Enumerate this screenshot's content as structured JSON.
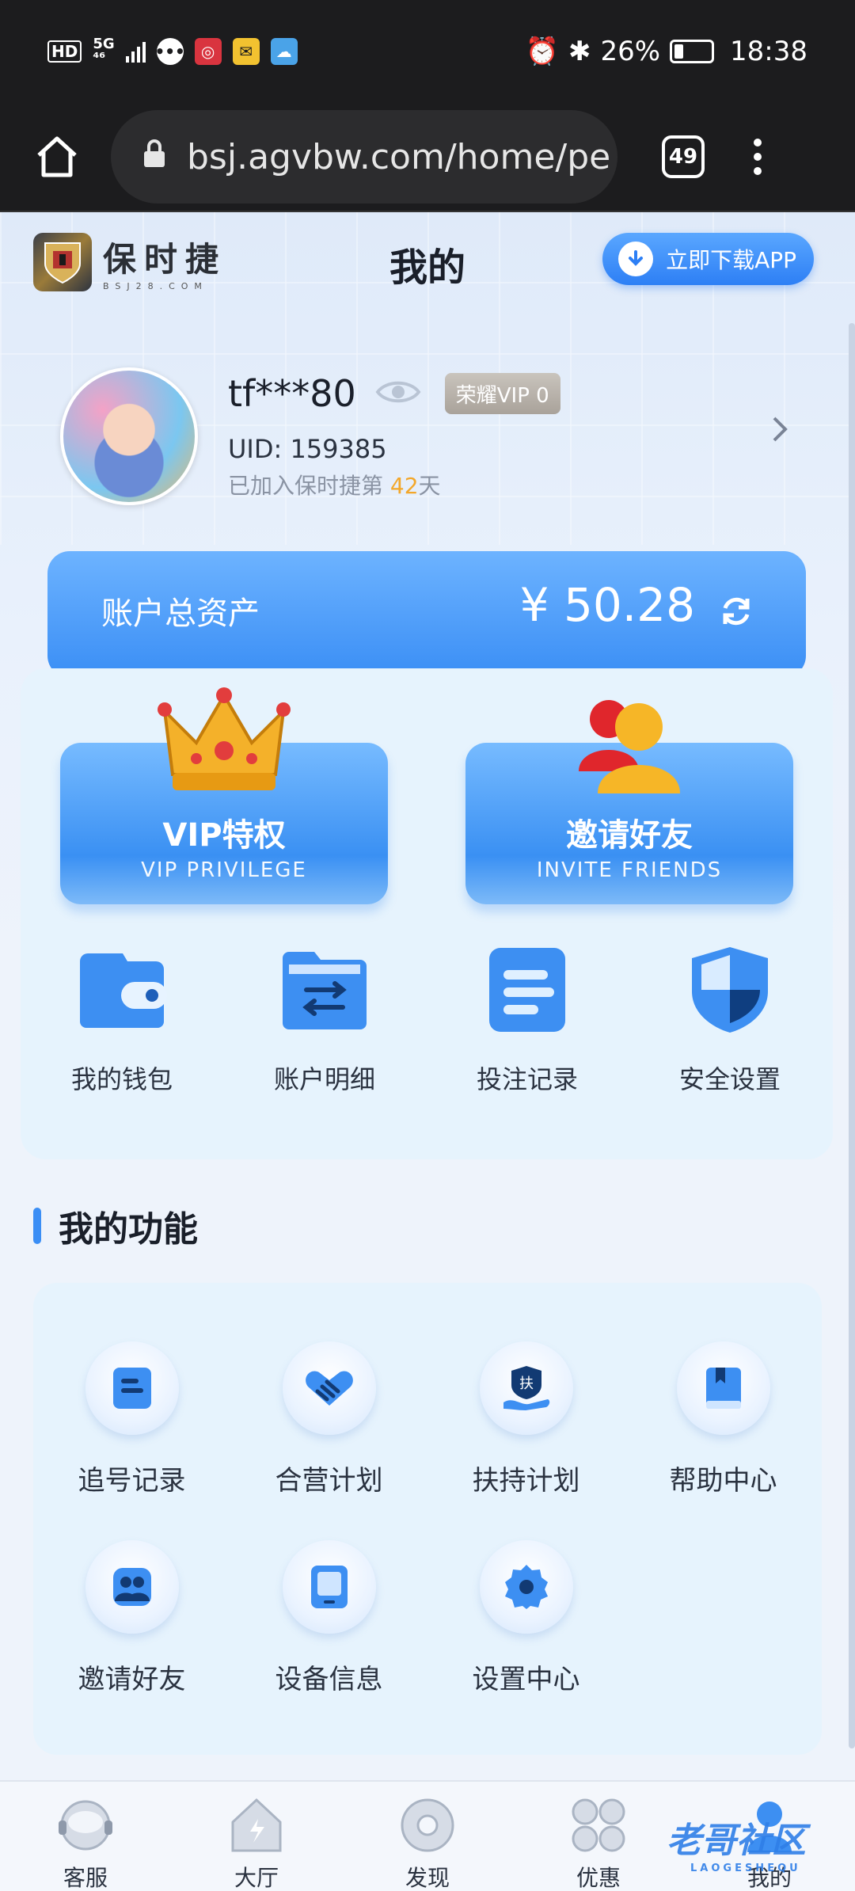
{
  "status_bar": {
    "network": "HD 5G",
    "alarm_icon": "alarm-icon",
    "bluetooth_icon": "bluetooth-icon",
    "battery_percent": "26%",
    "battery_level": 0.26,
    "time": "18:38"
  },
  "browser": {
    "url": "bsj.agvbw.com/home/pe",
    "tab_count": "49"
  },
  "header": {
    "logo_cn": "保时捷",
    "logo_en": "BSJ28.COM",
    "title": "我的",
    "download_label": "立即下载APP"
  },
  "profile": {
    "username": "tf***80",
    "vip_label": "荣耀VIP 0",
    "uid": "UID: 159385",
    "joined_prefix": "已加入保时捷第 ",
    "joined_days": "42",
    "joined_suffix": "天"
  },
  "assets": {
    "label": "账户总资产",
    "value": "¥ 50.28"
  },
  "cards": {
    "vip_title": "VIP特权",
    "vip_sub": "VIP PRIVILEGE",
    "invite_title": "邀请好友",
    "invite_sub": "INVITE FRIENDS"
  },
  "quick": [
    {
      "label": "我的钱包",
      "icon": "wallet-icon"
    },
    {
      "label": "账户明细",
      "icon": "folder-transfer-icon"
    },
    {
      "label": "投注记录",
      "icon": "record-icon"
    },
    {
      "label": "安全设置",
      "icon": "shield-icon"
    }
  ],
  "functions": {
    "title": "我的功能",
    "items": [
      {
        "label": "追号记录",
        "icon": "note-icon"
      },
      {
        "label": "合营计划",
        "icon": "handshake-icon"
      },
      {
        "label": "扶持计划",
        "icon": "support-icon"
      },
      {
        "label": "帮助中心",
        "icon": "book-icon"
      },
      {
        "label": "邀请好友",
        "icon": "users-icon"
      },
      {
        "label": "设备信息",
        "icon": "tablet-icon"
      },
      {
        "label": "设置中心",
        "icon": "gear-icon"
      }
    ]
  },
  "nav": [
    {
      "label": "客服",
      "icon": "headset-icon"
    },
    {
      "label": "大厅",
      "icon": "home-icon"
    },
    {
      "label": "发现",
      "icon": "disc-icon"
    },
    {
      "label": "优惠",
      "icon": "clover-icon"
    },
    {
      "label": "我的",
      "icon": "user-icon"
    }
  ],
  "watermark": {
    "text": "老哥社区",
    "sub": "LAOGESHEQU"
  },
  "colors": {
    "primary": "#3a8ef5",
    "accent": "#f3a72a"
  }
}
